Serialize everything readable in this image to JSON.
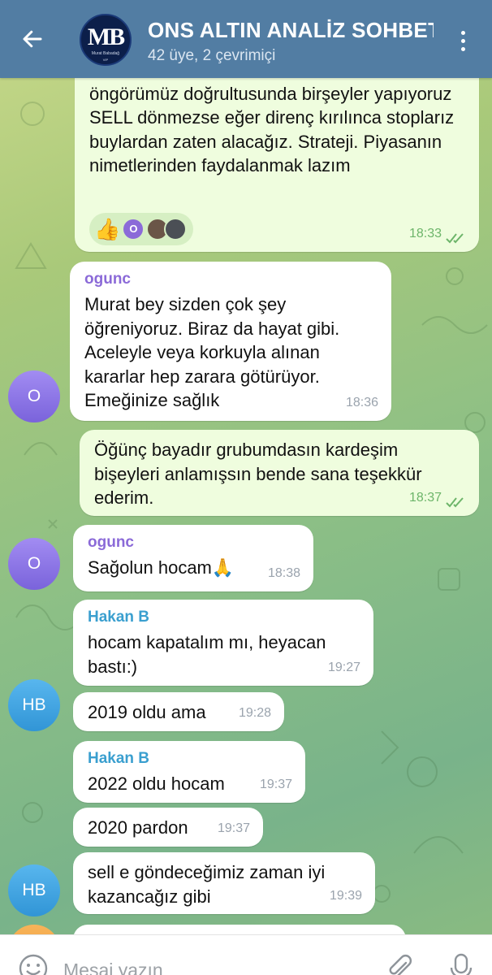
{
  "header": {
    "title": "ONS ALTIN ANALİZ SOHBET",
    "subtitle": "42 üye, 2 çevrimiçi",
    "logo_mark": "MB",
    "logo_name": "Murat Babadağ",
    "logo_tag": "VIP"
  },
  "messages": [
    {
      "direction": "out",
      "text": "Yani her işlemin kar ile sonuçlanma şansı yok öngörümüz doğrultusunda birşeyler yapıyoruz SELL dönmezse eğer direnç kırılınca stoplarız buylardan zaten alacağız. Strateji. Piyasanın nimetlerinden faydalanmak lazım",
      "time": "18:33",
      "reactions": {
        "emoji": "👍",
        "avatar_letter": "O"
      }
    },
    {
      "direction": "in",
      "sender": "ogunc",
      "text": "Murat bey sizden çok şey öğreniyoruz. Biraz da hayat gibi. Aceleyle veya korkuyla alınan kararlar hep zarara götürüyor. Emeğinize sağlık",
      "time": "18:36",
      "avatar": "O"
    },
    {
      "direction": "out",
      "text": "Öğünç bayadır grubumdasın kardeşim bişeyleri anlamışsın bende sana teşekkür ederim.",
      "time": "18:37"
    },
    {
      "direction": "in",
      "sender": "ogunc",
      "text": "Sağolun hocam🙏",
      "time": "18:38",
      "avatar": "O"
    },
    {
      "direction": "in",
      "sender": "Hakan B",
      "text": "hocam kapatalım mı, heyacan bastı:)",
      "time": "19:27"
    },
    {
      "direction": "in",
      "text": "2019 oldu ama",
      "time": "19:28",
      "avatar": "HB"
    },
    {
      "direction": "in",
      "sender": "Hakan B",
      "text": "2022 oldu hocam",
      "time": "19:37"
    },
    {
      "direction": "in",
      "text": "2020 pardon",
      "time": "19:37"
    },
    {
      "direction": "in",
      "text": "sell e göndeceğimiz zaman iyi kazancağız gibi",
      "time": "19:39",
      "avatar": "HB"
    }
  ],
  "input": {
    "placeholder": "Mesaj yazın"
  },
  "icons": {
    "back": "arrow-left-icon",
    "menu": "more-vertical-icon",
    "emoji": "smiley-icon",
    "attach": "paperclip-icon",
    "mic": "microphone-icon",
    "read": "double-check-icon"
  },
  "colors": {
    "header": "#527da3",
    "incoming_bubble": "#ffffff",
    "outgoing_bubble": "#effdde",
    "sender_ogunc": "#8b6ad8",
    "sender_hakan": "#3a9fcf",
    "read_ticks": "#6db56a"
  }
}
